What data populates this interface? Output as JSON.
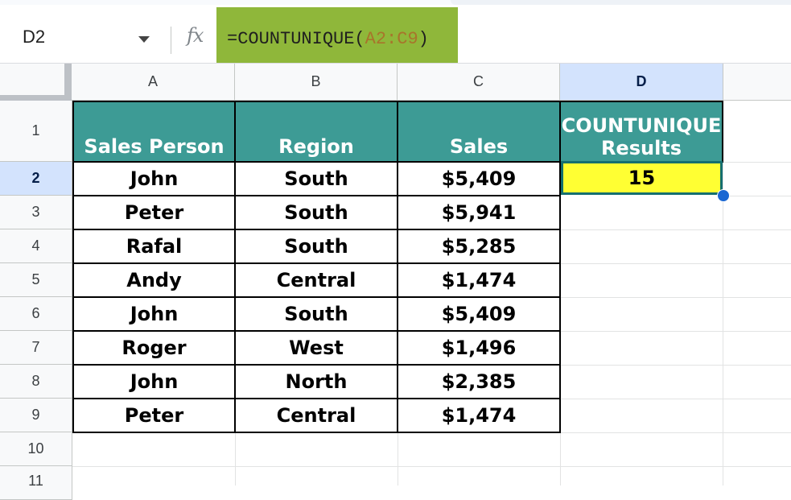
{
  "formula_bar": {
    "name_box": "D2",
    "fx_label": "fx",
    "formula_prefix": "=COUNTUNIQUE(",
    "formula_range": "A2:C9",
    "formula_suffix": ")"
  },
  "columns": [
    "A",
    "B",
    "C",
    "D"
  ],
  "selected_column": "D",
  "rows": [
    "1",
    "2",
    "3",
    "4",
    "5",
    "6",
    "7",
    "8",
    "9",
    "10",
    "11"
  ],
  "selected_row": "2",
  "table": {
    "headers": [
      "Sales Person",
      "Region",
      "Sales"
    ],
    "records": [
      [
        "John",
        "South",
        "$5,409"
      ],
      [
        "Peter",
        "South",
        "$5,941"
      ],
      [
        "Rafal",
        "South",
        "$5,285"
      ],
      [
        "Andy",
        "Central",
        "$1,474"
      ],
      [
        "John",
        "South",
        "$5,409"
      ],
      [
        "Roger",
        "West",
        "$1,496"
      ],
      [
        "John",
        "North",
        "$2,385"
      ],
      [
        "Peter",
        "Central",
        "$1,474"
      ]
    ]
  },
  "result": {
    "header_line1": "COUNTUNIQUE",
    "header_line2": "Results",
    "value": "15"
  },
  "colors": {
    "header_fill": "#3d9b95",
    "result_fill": "#ffff33",
    "formula_highlight": "#8fb73a",
    "selection": "#d3e3fd"
  }
}
